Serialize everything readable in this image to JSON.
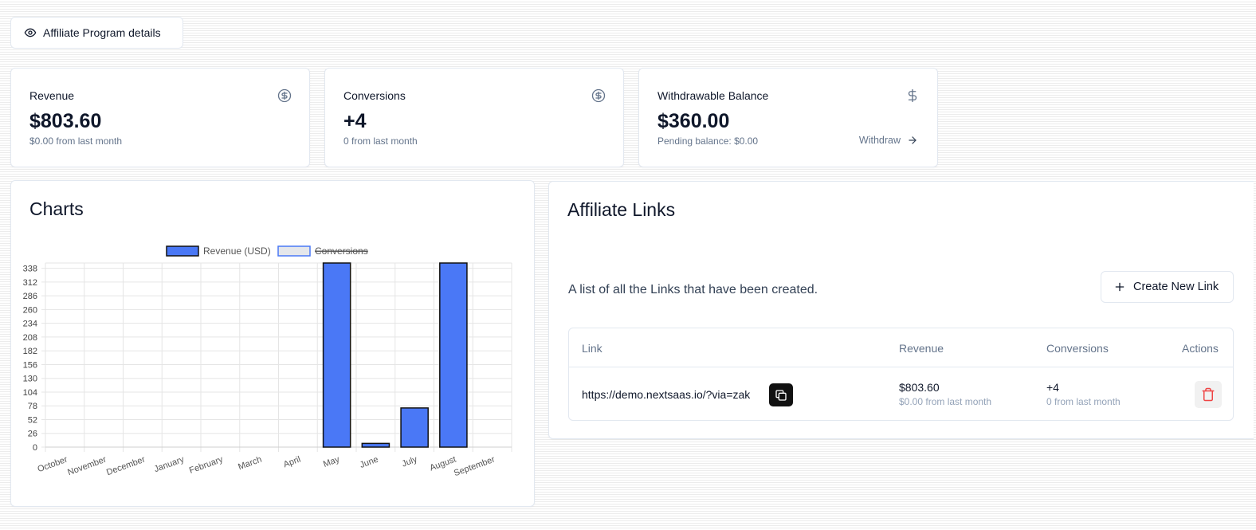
{
  "details_button": {
    "label": "Affiliate Program details",
    "icon": "eye-icon"
  },
  "stats": [
    {
      "title": "Revenue",
      "value": "$803.60",
      "sub": "$0.00 from last month",
      "icon": "circle-dollar-icon"
    },
    {
      "title": "Conversions",
      "value": "+4",
      "sub": "0 from last month",
      "icon": "circle-dollar-icon"
    },
    {
      "title": "Withdrawable Balance",
      "value": "$360.00",
      "sub": "Pending balance: $0.00",
      "icon": "dollar-sign-icon",
      "action": "Withdraw"
    }
  ],
  "charts": {
    "title": "Charts"
  },
  "links": {
    "title": "Affiliate Links",
    "description": "A list of all the Links that have been created.",
    "create_label": "Create New Link",
    "columns": [
      "Link",
      "Revenue",
      "Conversions",
      "Actions"
    ],
    "rows": [
      {
        "link": "https://demo.nextsaas.io/?via=zak",
        "revenue": "$803.60",
        "revenue_sub": "$0.00 from last month",
        "conversions": "+4",
        "conversions_sub": "0 from last month"
      }
    ]
  },
  "chart_data": {
    "type": "bar",
    "categories": [
      "October",
      "November",
      "December",
      "January",
      "February",
      "March",
      "April",
      "May",
      "June",
      "July",
      "August",
      "September"
    ],
    "series": [
      {
        "name": "Revenue (USD)",
        "values": [
          0,
          0,
          0,
          0,
          0,
          0,
          0,
          348,
          7,
          74,
          348,
          0
        ],
        "color": "#4a78f6",
        "visible": true
      },
      {
        "name": "Conversions",
        "values": [
          0,
          0,
          0,
          0,
          0,
          0,
          0,
          1,
          1,
          1,
          1,
          0
        ],
        "color": "#e5e7eb",
        "visible": false
      }
    ],
    "y_ticks": [
      0,
      26,
      52,
      78,
      104,
      130,
      156,
      182,
      208,
      234,
      260,
      286,
      312,
      338
    ],
    "ylim": [
      0,
      348
    ],
    "grid": true,
    "legend": "top-center"
  }
}
